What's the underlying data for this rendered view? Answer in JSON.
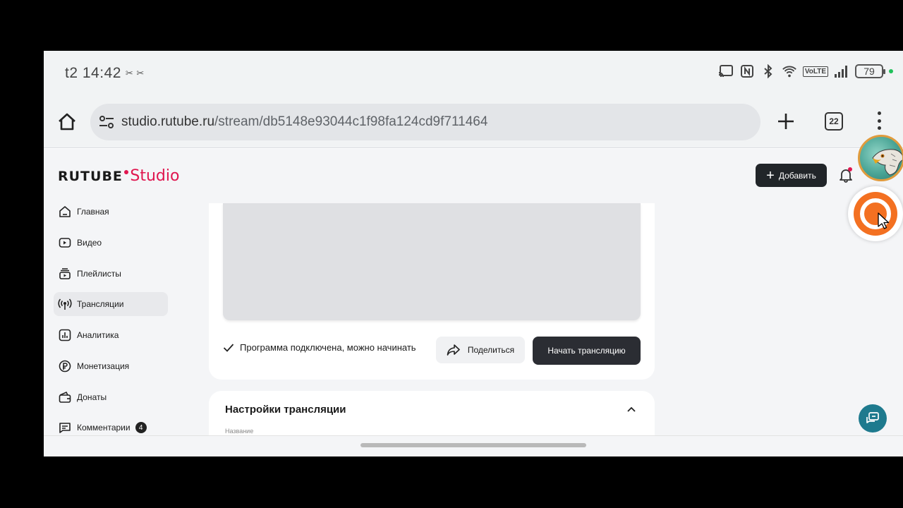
{
  "statusbar": {
    "carrier_time": "t2 14:42",
    "glyphs": "✂ ✂",
    "volte": "VoLTE",
    "battery": "79"
  },
  "browser": {
    "url_host": "studio.rutube.ru",
    "url_path": "/stream/db5148e93044c1f98fa124cd9f711464",
    "tab_count": "22"
  },
  "header": {
    "logo_main": "RUTUBE",
    "logo_studio": "Studio",
    "add_label": "Добавить"
  },
  "sidebar": {
    "items": [
      {
        "label": "Главная",
        "icon": "home-icon"
      },
      {
        "label": "Видео",
        "icon": "video-icon"
      },
      {
        "label": "Плейлисты",
        "icon": "playlist-icon"
      },
      {
        "label": "Трансляции",
        "icon": "broadcast-icon",
        "active": true
      },
      {
        "label": "Аналитика",
        "icon": "analytics-icon"
      },
      {
        "label": "Монетизация",
        "icon": "ruble-icon"
      },
      {
        "label": "Донаты",
        "icon": "wallet-icon"
      },
      {
        "label": "Комментарии",
        "icon": "comments-icon",
        "badge": "4"
      }
    ]
  },
  "stream": {
    "status_text": "Программа подключена, можно начинать",
    "share_label": "Поделиться",
    "start_label": "Начать трансляцию"
  },
  "settings": {
    "title": "Настройки трансляции",
    "field_label": "Название"
  },
  "colors": {
    "brand": "#e0164f",
    "dark_button": "#2b2d33",
    "chat_button": "#1e7a8e",
    "record_overlay": "#f37021"
  }
}
